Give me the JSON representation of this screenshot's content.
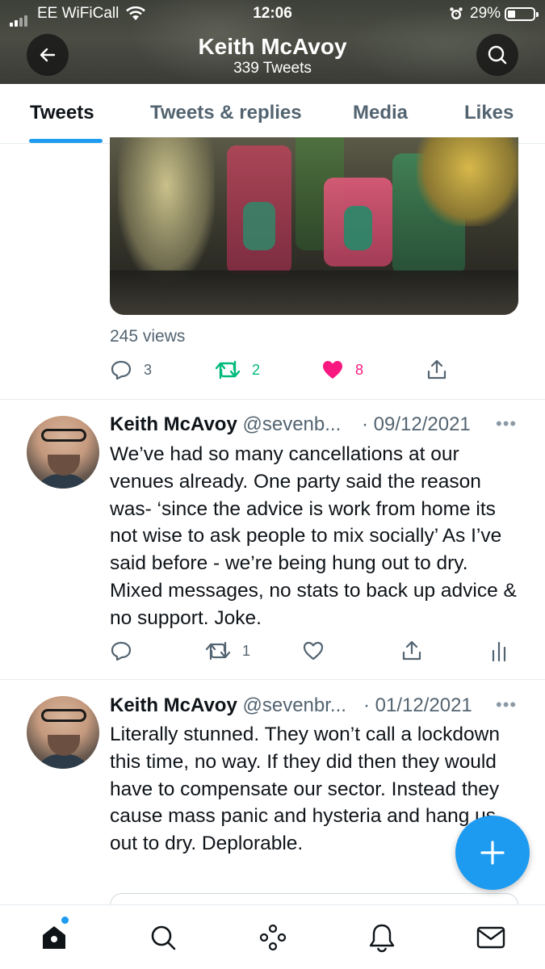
{
  "status_bar": {
    "carrier": "EE WiFiCall",
    "time": "12:06",
    "battery": "29%"
  },
  "header": {
    "name": "Keith McAvoy",
    "tweet_count": "339 Tweets"
  },
  "tabs": [
    {
      "label": "Tweets",
      "active": true
    },
    {
      "label": "Tweets & replies",
      "active": false
    },
    {
      "label": "Media",
      "active": false
    },
    {
      "label": "Likes",
      "active": false
    }
  ],
  "first_tweet": {
    "views": "245 views",
    "replies": "3",
    "retweets": "2",
    "likes": "8"
  },
  "tweets": [
    {
      "name": "Keith McAvoy",
      "handle": "@sevenb...",
      "date": "· 09/12/2021",
      "text": "We’ve had so many cancellations at our venues already. One party said the reason was- ‘since the advice is work from home its not wise to ask people to mix socially’ As I’ve said before - we’re being hung out to dry. Mixed messages, no stats to back up advice & no support. Joke.",
      "retweets": "1"
    },
    {
      "name": "Keith McAvoy",
      "handle": "@sevenbr...",
      "date": "· 01/12/2021",
      "text": "Literally stunned. They won’t call a lockdown this time, no way.  If they did then they would have to compensate our sector. Instead they cause mass panic and hysteria and hang us out to dry. Deplorable."
    }
  ],
  "colors": {
    "accent": "#1d9bf0",
    "retweet": "#00ba7c",
    "like": "#f91880",
    "secondary_text": "#536471"
  }
}
